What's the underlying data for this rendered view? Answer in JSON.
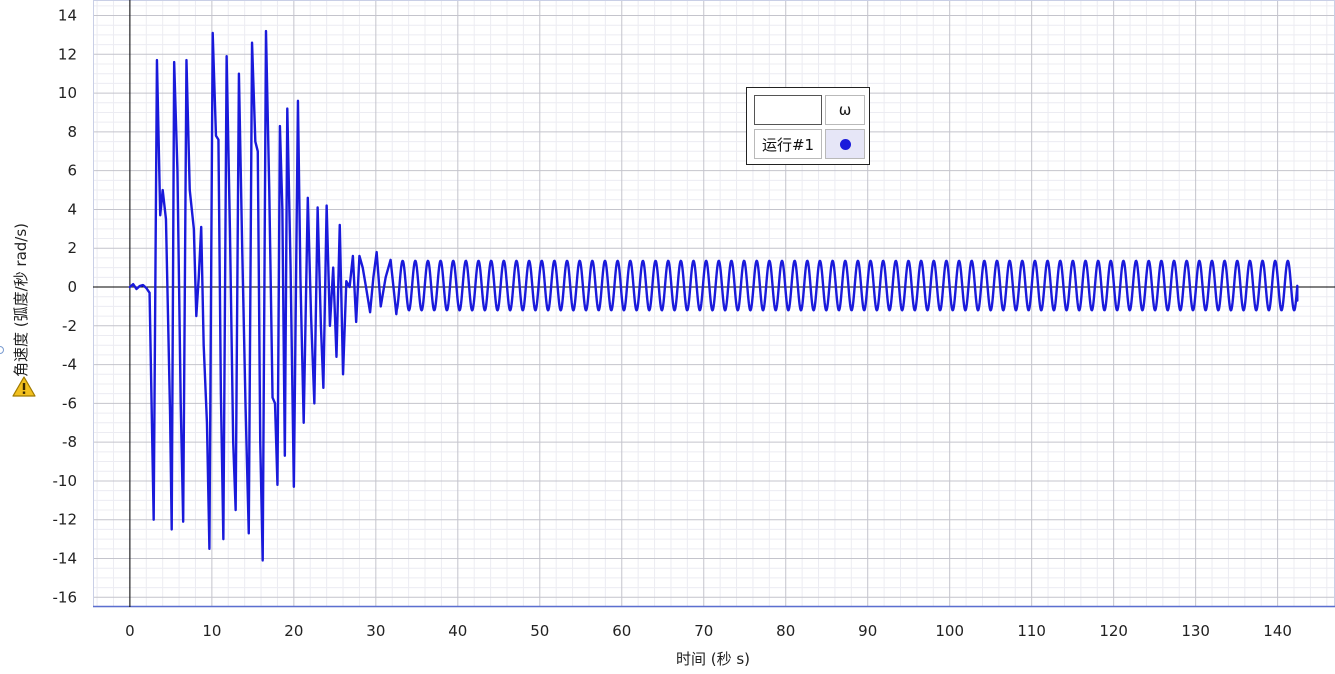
{
  "chart_data": {
    "type": "line",
    "xlabel": "时间 (秒 s)",
    "ylabel": "角速度 (弧度/秒 rad/s)",
    "xlim": [
      -4.5,
      147
    ],
    "ylim": [
      -16.5,
      14.8
    ],
    "x_ticks": [
      0,
      10,
      20,
      30,
      40,
      50,
      60,
      70,
      80,
      90,
      100,
      110,
      120,
      130,
      140
    ],
    "y_ticks": [
      14,
      12,
      10,
      8,
      6,
      4,
      2,
      0,
      -2,
      -4,
      -6,
      -8,
      -10,
      -12,
      -14,
      -16
    ],
    "grid": true,
    "legend_position": "top-center",
    "series": [
      {
        "name": "运行#1",
        "color": "#1a1adb",
        "points": [
          [
            0,
            0
          ],
          [
            0.4,
            0.15
          ],
          [
            0.8,
            -0.1
          ],
          [
            1.2,
            0.05
          ],
          [
            1.6,
            0.1
          ],
          [
            2.0,
            -0.05
          ],
          [
            2.4,
            -0.3
          ],
          [
            2.9,
            -12.0
          ],
          [
            3.3,
            11.7
          ],
          [
            3.7,
            3.7
          ],
          [
            4.0,
            5.0
          ],
          [
            4.4,
            3.5
          ],
          [
            4.9,
            -6.5
          ],
          [
            5.1,
            -12.5
          ],
          [
            5.4,
            11.6
          ],
          [
            5.8,
            6.0
          ],
          [
            6.2,
            -6.0
          ],
          [
            6.5,
            -12.1
          ],
          [
            6.9,
            11.7
          ],
          [
            7.3,
            5.0
          ],
          [
            7.8,
            3.0
          ],
          [
            8.1,
            -1.5
          ],
          [
            8.4,
            0.5
          ],
          [
            8.7,
            3.1
          ],
          [
            9.0,
            -3.0
          ],
          [
            9.4,
            -7.0
          ],
          [
            9.7,
            -13.5
          ],
          [
            10.1,
            13.1
          ],
          [
            10.5,
            7.8
          ],
          [
            10.8,
            7.6
          ],
          [
            11.1,
            -5.5
          ],
          [
            11.4,
            -13.0
          ],
          [
            11.8,
            11.9
          ],
          [
            12.2,
            3.0
          ],
          [
            12.6,
            -8.0
          ],
          [
            12.9,
            -11.5
          ],
          [
            13.3,
            11.0
          ],
          [
            13.7,
            2.0
          ],
          [
            14.1,
            -6.0
          ],
          [
            14.5,
            -12.7
          ],
          [
            14.9,
            12.6
          ],
          [
            15.3,
            7.5
          ],
          [
            15.6,
            7.0
          ],
          [
            15.9,
            -8.0
          ],
          [
            16.2,
            -14.1
          ],
          [
            16.6,
            13.2
          ],
          [
            17.0,
            5.0
          ],
          [
            17.4,
            -5.7
          ],
          [
            17.7,
            -6.0
          ],
          [
            18.0,
            -10.2
          ],
          [
            18.3,
            8.3
          ],
          [
            18.6,
            4.0
          ],
          [
            18.9,
            -8.7
          ],
          [
            19.2,
            9.2
          ],
          [
            19.6,
            1.0
          ],
          [
            20.0,
            -10.3
          ],
          [
            20.5,
            9.6
          ],
          [
            20.8,
            0.5
          ],
          [
            21.2,
            -7.0
          ],
          [
            21.7,
            4.6
          ],
          [
            22.1,
            -1.5
          ],
          [
            22.5,
            -6.0
          ],
          [
            22.9,
            4.1
          ],
          [
            23.3,
            -2.0
          ],
          [
            23.6,
            -5.2
          ],
          [
            24.0,
            4.2
          ],
          [
            24.4,
            -2.0
          ],
          [
            24.8,
            1.0
          ],
          [
            25.2,
            -3.6
          ],
          [
            25.6,
            3.2
          ],
          [
            26.0,
            -4.5
          ],
          [
            26.4,
            0.3
          ],
          [
            26.8,
            0.0
          ],
          [
            27.2,
            1.6
          ],
          [
            27.6,
            -1.8
          ],
          [
            28.0,
            1.6
          ],
          [
            28.4,
            1.0
          ],
          [
            28.8,
            0.0
          ],
          [
            29.3,
            -1.3
          ],
          [
            29.7,
            0.5
          ],
          [
            30.1,
            1.8
          ],
          [
            30.6,
            -1.0
          ],
          [
            31.2,
            0.5
          ],
          [
            31.8,
            1.4
          ],
          [
            32.5,
            -1.4
          ]
        ],
        "steady": {
          "start": 32.5,
          "end": 142.4,
          "period": 1.5425,
          "max": 1.35,
          "min": -1.2,
          "end_value": -0.7
        }
      }
    ]
  },
  "legend": {
    "header_blank": "",
    "header_symbol": "ω",
    "run_label": "运行#1",
    "marker_color": "#1a1adb"
  },
  "icons": {
    "warning": "warning-icon"
  }
}
